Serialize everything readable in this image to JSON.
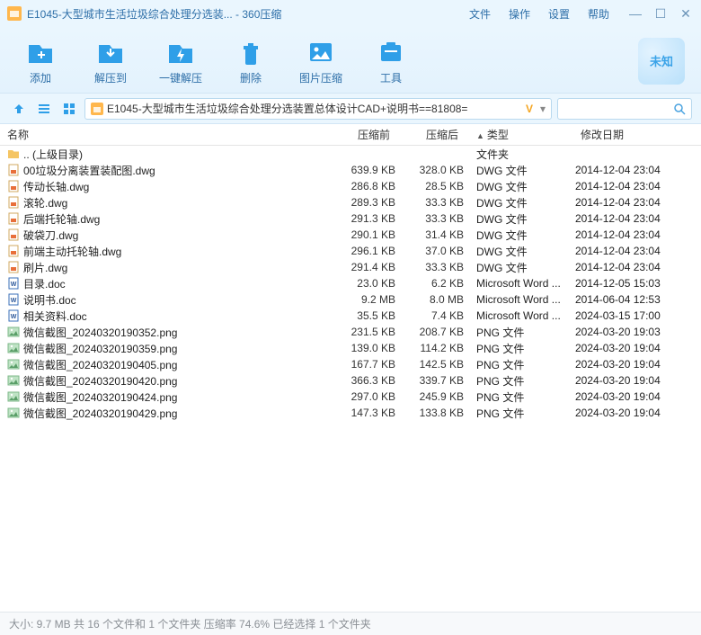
{
  "window": {
    "title": "E1045-大型城市生活垃圾综合处理分选装... - 360压缩"
  },
  "menu": {
    "file": "文件",
    "op": "操作",
    "settings": "设置",
    "help": "帮助"
  },
  "toolbar": {
    "add": "添加",
    "extract": "解压到",
    "oneclick": "一键解压",
    "delete": "删除",
    "imgcompress": "图片压缩",
    "tools": "工具",
    "unknown": "未知"
  },
  "path": {
    "text": "E1045-大型城市生活垃圾综合处理分选装置总体设计CAD+说明书==81808="
  },
  "columns": {
    "name": "名称",
    "before": "压缩前",
    "after": "压缩后",
    "type": "类型",
    "date": "修改日期"
  },
  "parent": {
    "label": ".. (上级目录)",
    "type": "文件夹"
  },
  "files": [
    {
      "icon": "dwg",
      "name": "00垃圾分离装置装配图.dwg",
      "before": "639.9 KB",
      "after": "328.0 KB",
      "type": "DWG 文件",
      "date": "2014-12-04 23:04"
    },
    {
      "icon": "dwg",
      "name": "传动长轴.dwg",
      "before": "286.8 KB",
      "after": "28.5 KB",
      "type": "DWG 文件",
      "date": "2014-12-04 23:04"
    },
    {
      "icon": "dwg",
      "name": "滚轮.dwg",
      "before": "289.3 KB",
      "after": "33.3 KB",
      "type": "DWG 文件",
      "date": "2014-12-04 23:04"
    },
    {
      "icon": "dwg",
      "name": "后端托轮轴.dwg",
      "before": "291.3 KB",
      "after": "33.3 KB",
      "type": "DWG 文件",
      "date": "2014-12-04 23:04"
    },
    {
      "icon": "dwg",
      "name": "破袋刀.dwg",
      "before": "290.1 KB",
      "after": "31.4 KB",
      "type": "DWG 文件",
      "date": "2014-12-04 23:04"
    },
    {
      "icon": "dwg",
      "name": "前端主动托轮轴.dwg",
      "before": "296.1 KB",
      "after": "37.0 KB",
      "type": "DWG 文件",
      "date": "2014-12-04 23:04"
    },
    {
      "icon": "dwg",
      "name": "刷片.dwg",
      "before": "291.4 KB",
      "after": "33.3 KB",
      "type": "DWG 文件",
      "date": "2014-12-04 23:04"
    },
    {
      "icon": "doc",
      "name": "目录.doc",
      "before": "23.0 KB",
      "after": "6.2 KB",
      "type": "Microsoft Word ...",
      "date": "2014-12-05 15:03"
    },
    {
      "icon": "doc",
      "name": "说明书.doc",
      "before": "9.2 MB",
      "after": "8.0 MB",
      "type": "Microsoft Word ...",
      "date": "2014-06-04 12:53"
    },
    {
      "icon": "doc",
      "name": "相关资料.doc",
      "before": "35.5 KB",
      "after": "7.4 KB",
      "type": "Microsoft Word ...",
      "date": "2024-03-15 17:00"
    },
    {
      "icon": "png",
      "name": "微信截图_20240320190352.png",
      "before": "231.5 KB",
      "after": "208.7 KB",
      "type": "PNG 文件",
      "date": "2024-03-20 19:03"
    },
    {
      "icon": "png",
      "name": "微信截图_20240320190359.png",
      "before": "139.0 KB",
      "after": "114.2 KB",
      "type": "PNG 文件",
      "date": "2024-03-20 19:04"
    },
    {
      "icon": "png",
      "name": "微信截图_20240320190405.png",
      "before": "167.7 KB",
      "after": "142.5 KB",
      "type": "PNG 文件",
      "date": "2024-03-20 19:04"
    },
    {
      "icon": "png",
      "name": "微信截图_20240320190420.png",
      "before": "366.3 KB",
      "after": "339.7 KB",
      "type": "PNG 文件",
      "date": "2024-03-20 19:04"
    },
    {
      "icon": "png",
      "name": "微信截图_20240320190424.png",
      "before": "297.0 KB",
      "after": "245.9 KB",
      "type": "PNG 文件",
      "date": "2024-03-20 19:04"
    },
    {
      "icon": "png",
      "name": "微信截图_20240320190429.png",
      "before": "147.3 KB",
      "after": "133.8 KB",
      "type": "PNG 文件",
      "date": "2024-03-20 19:04"
    }
  ],
  "status": "大小: 9.7 MB 共 16 个文件和 1 个文件夹 压缩率 74.6% 已经选择 1 个文件夹"
}
